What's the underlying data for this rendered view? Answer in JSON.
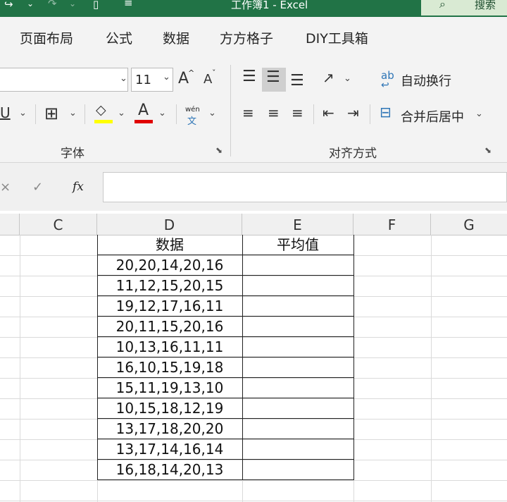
{
  "window": {
    "title": "工作簿1 - Excel",
    "search_label": "搜索"
  },
  "ribbon_tabs": [
    "页面布局",
    "公式",
    "数据",
    "方方格子",
    "DIY工具箱"
  ],
  "font_group": {
    "label": "字体",
    "font_size": "11",
    "grow_icon": "A",
    "shrink_icon": "A",
    "underline": "U",
    "font_color_glyph": "A",
    "phonetic_top": "wén",
    "phonetic_bottom": "文",
    "fill_color": "#ffff00",
    "font_color": "#e00000"
  },
  "align_group": {
    "label": "对齐方式",
    "wrap_text": "自动换行",
    "merge_center": "合并后居中",
    "wrap_icon_text": "ab"
  },
  "formula_bar": {
    "fx": "fx",
    "value": ""
  },
  "columns": [
    "C",
    "D",
    "E",
    "F",
    "G"
  ],
  "table": {
    "header_data": "数据",
    "header_avg": "平均值",
    "rows": [
      "20,20,14,20,16",
      "11,12,15,20,15",
      "19,12,17,16,11",
      "20,11,15,20,16",
      "10,13,16,11,11",
      "16,10,15,19,18",
      "15,11,19,13,10",
      "10,15,18,12,19",
      "13,17,18,20,20",
      "13,17,14,16,14",
      "16,18,14,20,13"
    ]
  }
}
